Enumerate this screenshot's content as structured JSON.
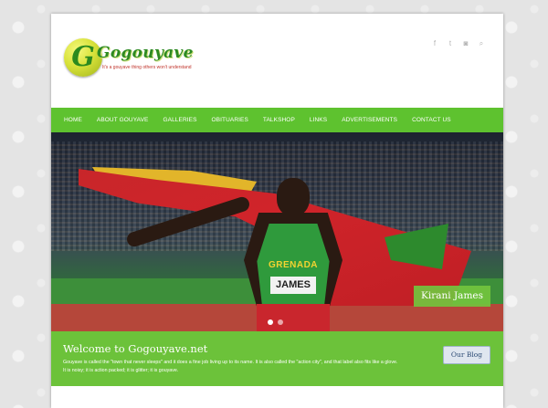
{
  "brand": {
    "logo_letter": "G",
    "name": "Gogouyave",
    "tagline": "It's a gouyave thing others won't understand"
  },
  "social": [
    {
      "icon": "facebook-icon",
      "glyph": "f"
    },
    {
      "icon": "twitter-icon",
      "glyph": "t"
    },
    {
      "icon": "rss-icon",
      "glyph": "◙"
    },
    {
      "icon": "search-icon",
      "glyph": "⌕"
    }
  ],
  "nav": {
    "items": [
      "HOME",
      "ABOUT GOUYAVE",
      "GALLERIES",
      "OBITUARIES",
      "TALKSHOP",
      "LINKS",
      "ADVERTISEMENTS",
      "CONTACT US"
    ]
  },
  "hero": {
    "caption": "Kirani James",
    "vest_text": "GRENADA",
    "bib_text": "JAMES"
  },
  "welcome": {
    "title": "Welcome to Gogouyave.net",
    "body": "Gouyave is called the \"town that never sleeps\" and it does a fine job living up to its name. It is also called the \"action city\", and that label also fits like a glove. It is noisy; it is action packed; it is glitter; it is gouyave.",
    "blog_button": "Our Blog"
  },
  "colors": {
    "accent_green": "#5ec22f",
    "welcome_green": "#6cc23a",
    "logo_red": "#c0342b"
  }
}
